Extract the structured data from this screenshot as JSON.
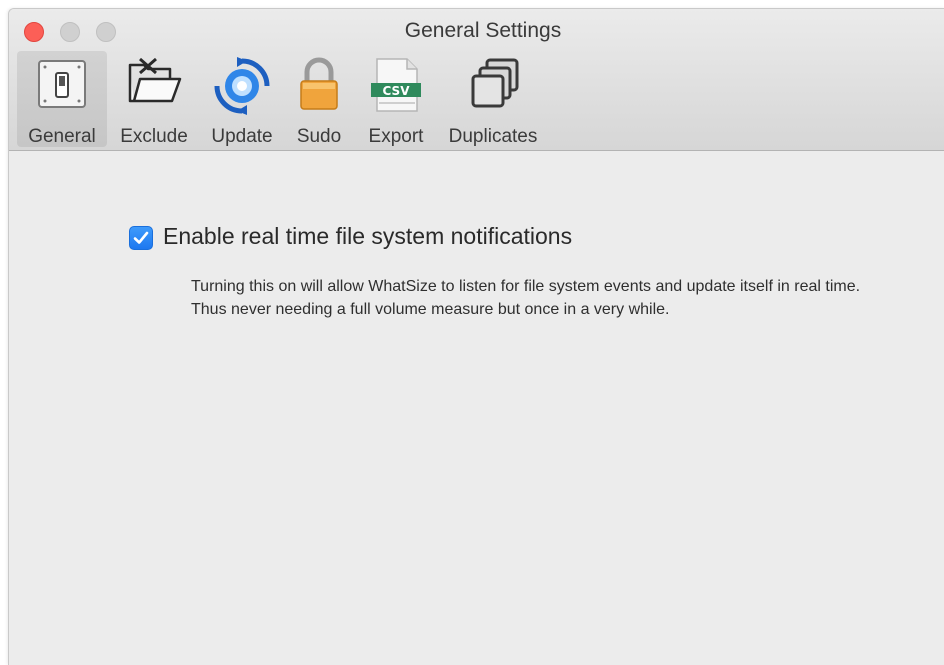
{
  "window": {
    "title": "General Settings"
  },
  "toolbar": {
    "items": [
      {
        "label": "General",
        "icon": "toggle-switch-icon",
        "selected": true
      },
      {
        "label": "Exclude",
        "icon": "folder-exclude-icon",
        "selected": false
      },
      {
        "label": "Update",
        "icon": "refresh-icon",
        "selected": false
      },
      {
        "label": "Sudo",
        "icon": "lock-icon",
        "selected": false
      },
      {
        "label": "Export",
        "icon": "csv-file-icon",
        "selected": false
      },
      {
        "label": "Duplicates",
        "icon": "duplicates-icon",
        "selected": false
      }
    ],
    "csv_badge": "CSV"
  },
  "settings": {
    "realtime_checkbox": {
      "label": "Enable real time file system notifications",
      "checked": true
    },
    "description_line1": "Turning this on will allow WhatSize to listen for file system events and update itself in real time.",
    "description_line2": "Thus never needing a full volume measure but once in a very while."
  },
  "colors": {
    "accent": "#1d78f0",
    "close": "#fc5f57",
    "lock": "#f0a43c",
    "update": "#1f6fd6",
    "csv": "#2f8a5c"
  }
}
